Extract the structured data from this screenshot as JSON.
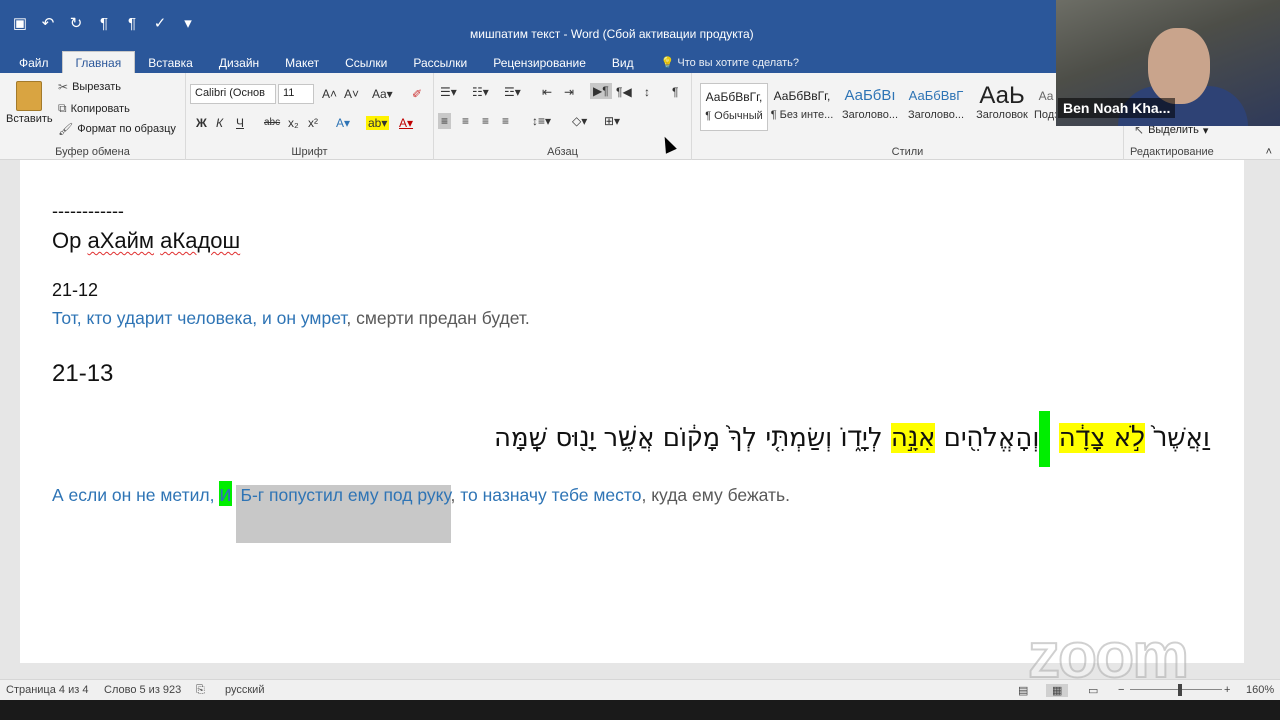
{
  "window": {
    "title": "мишпатим текст - Word (Сбой активации продукта)",
    "qat_icons": [
      "save-icon",
      "undo-icon",
      "redo-icon",
      "rtl-icon",
      "ltr-icon",
      "spelling-icon",
      "customize-icon"
    ]
  },
  "tabs": [
    "Файл",
    "Главная",
    "Вставка",
    "Дизайн",
    "Макет",
    "Ссылки",
    "Рассылки",
    "Рецензирование",
    "Вид"
  ],
  "tell_me": "Что вы хотите сделать?",
  "clipboard": {
    "paste": "Вставить",
    "cut": "Вырезать",
    "copy": "Копировать",
    "format_painter": "Формат по образцу",
    "label": "Буфер обмена"
  },
  "font": {
    "name": "Calibri (Основ",
    "size": "11",
    "bold": "Ж",
    "italic": "К",
    "underline": "Ч",
    "strike": "abc",
    "sub": "x₂",
    "sup": "x²",
    "label": "Шрифт"
  },
  "paragraph": {
    "label": "Абзац"
  },
  "styles": {
    "items": [
      {
        "preview": "АаБбВвГг,",
        "name": "¶ Обычный"
      },
      {
        "preview": "АаБбВвГг,",
        "name": "¶ Без инте..."
      },
      {
        "preview": "АаБбВı",
        "name": "Заголово..."
      },
      {
        "preview": "АаБбВвГ",
        "name": "Заголово..."
      },
      {
        "preview": "АаЬ",
        "name": "Заголовок"
      },
      {
        "preview": "Аа",
        "name": "Подзаг..."
      }
    ],
    "label": "Стили"
  },
  "editing": {
    "select": "Выделить",
    "label": "Редактирование"
  },
  "document": {
    "separator": "------------",
    "heading1": "Ор аХайм аКадош",
    "ref1": "21-12",
    "verse1_blue": "Тот, кто ударит человека, и он умрет",
    "verse1_gray": ", смерти предан будет.",
    "ref2": "21-13",
    "hebrew": {
      "part1": "וַאֲשֶׁר֙ ",
      "part2_hl": "לֹ֣א צָדָ֔ה",
      "part3_green": "",
      "part4": "וְ",
      "part5": "הָאֱלֹהִ֖ים ",
      "part6_hl": "אִנָּ֣ה",
      "part7": " לְיָד֑וֹ וְשַׂמְתִּ֤י לְךָ֙ מָק֔וֹם אֲשֶׁ֥ר יָנ֖וּס שָֽׁמָּה"
    },
    "verse2": {
      "a": "А если он не метил, ",
      "b_green": "и",
      "c": " ",
      "d_sel": "Б-г попустил ему под руку",
      "e": ", ",
      "f": "то назначу тебе место",
      "g": ", куда ему бежать."
    }
  },
  "status": {
    "page": "Страница 4 из 4",
    "words": "Слово 5 из 923",
    "lang": "русский",
    "zoom": "160%"
  },
  "video": {
    "name": "Ben Noah Kha..."
  },
  "watermark": "zoom"
}
